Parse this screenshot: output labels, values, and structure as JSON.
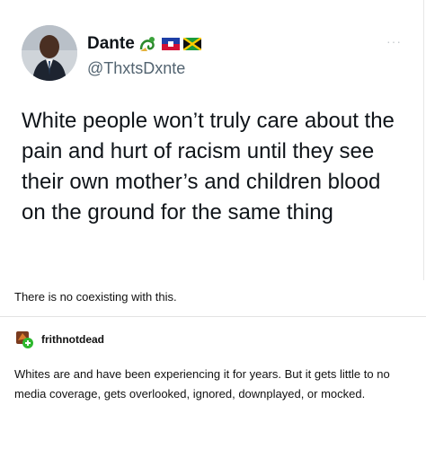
{
  "tweet": {
    "display_name": "Dante",
    "name_icons": [
      "dragon-icon",
      "haiti-flag-icon",
      "jamaica-flag-icon"
    ],
    "handle": "@ThxtsDxnte",
    "more_label": "···",
    "text": "White people won’t truly care about the pain and hurt of racism until they see their own mother’s and children blood on the ground for the same thing"
  },
  "caption": "There is no coexisting with this.",
  "reply": {
    "username": "frithnotdead",
    "text": "Whites are and have been experiencing it for years. But it gets little to no media coverage, gets overlooked, ignored, downplayed, or mocked."
  },
  "colors": {
    "handle": "#536471",
    "text": "#0f1419",
    "divider": "#e3e3e3",
    "badge_green": "#2eb82e"
  }
}
